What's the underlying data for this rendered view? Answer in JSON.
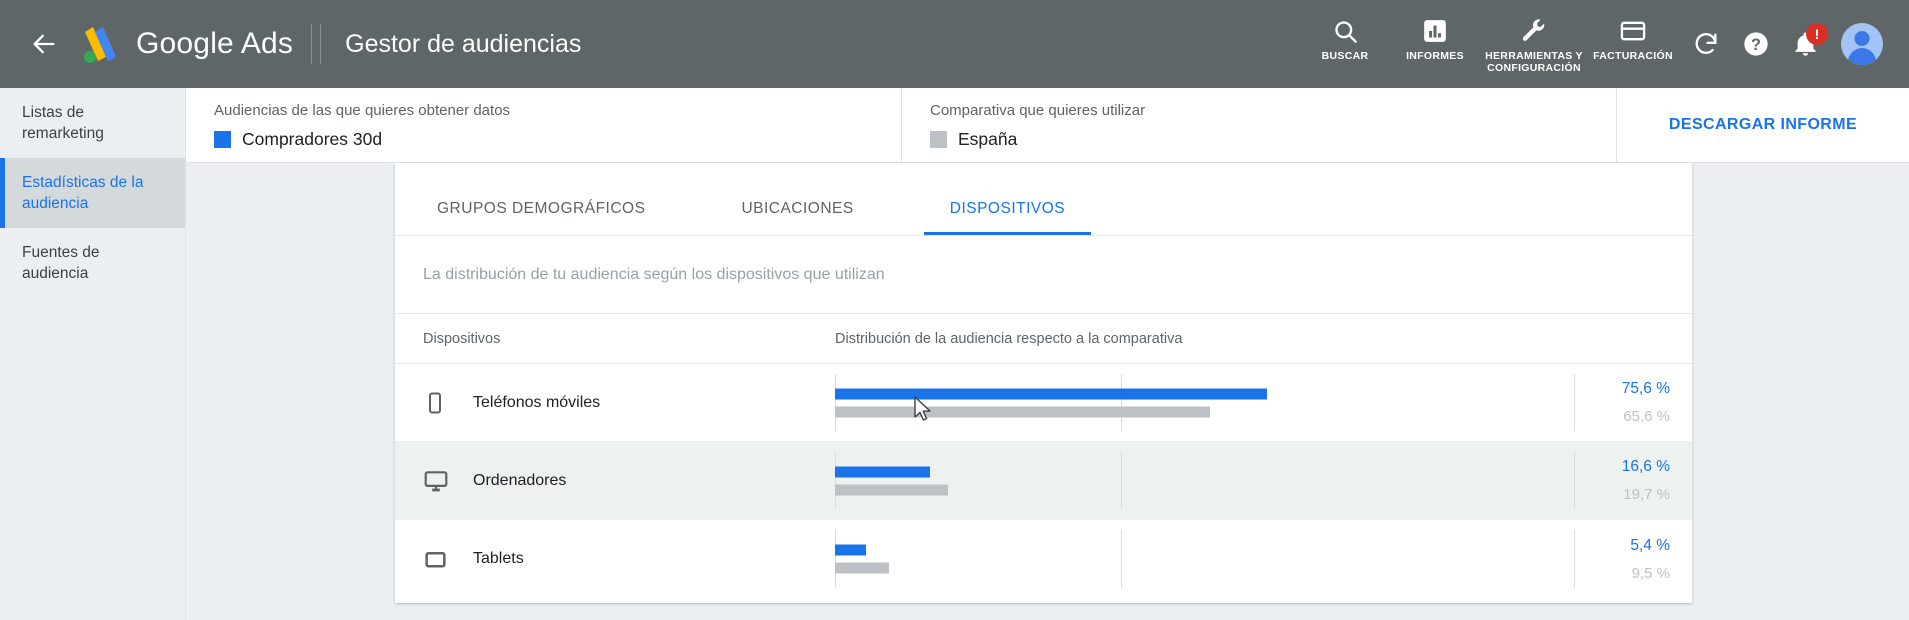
{
  "topbar": {
    "back_icon": "back-arrow-icon",
    "brand": "Google Ads",
    "page_title": "Gestor de audiencias",
    "tools": [
      {
        "label": "BUSCAR",
        "icon": "search-icon"
      },
      {
        "label": "INFORMES",
        "icon": "reports-bar-chart-icon"
      },
      {
        "label": "HERRAMIENTAS Y CONFIGURACIÓN",
        "icon": "wrench-tools-icon"
      },
      {
        "label": "FACTURACIÓN",
        "icon": "credit-card-icon"
      }
    ],
    "round_buttons": [
      {
        "icon": "refresh-icon"
      },
      {
        "icon": "help-question-icon"
      },
      {
        "icon": "notifications-bell-icon",
        "badge": "!"
      }
    ],
    "avatar": "user-avatar"
  },
  "sidebar": {
    "items": [
      {
        "label": "Listas de remarketing",
        "active": false
      },
      {
        "label": "Estadísticas de la audiencia",
        "active": true
      },
      {
        "label": "Fuentes de audiencia",
        "active": false
      }
    ]
  },
  "filterbar": {
    "audience": {
      "label": "Audiencias de las que quieres obtener datos",
      "value": "Compradores 30d",
      "swatch_color": "#1a73e8"
    },
    "benchmark": {
      "label": "Comparativa que quieres utilizar",
      "value": "España",
      "swatch_color": "#bdc1c6"
    },
    "download_label": "DESCARGAR INFORME"
  },
  "card": {
    "tabs": [
      {
        "label": "GRUPOS DEMOGRÁFICOS",
        "active": false
      },
      {
        "label": "UBICACIONES",
        "active": false
      },
      {
        "label": "DISPOSITIVOS",
        "active": true
      }
    ],
    "description": "La distribución de tu audiencia según los dispositivos que utilizan",
    "columns": {
      "device": "Dispositivos",
      "distribution": "Distribución de la audiencia respecto a la comparativa"
    }
  },
  "chart_data": {
    "type": "bar",
    "title": "Distribución de la audiencia respecto a la comparativa",
    "subtitle": "La distribución de tu audiencia según los dispositivos que utilizan",
    "orientation": "horizontal",
    "categories": [
      "Teléfonos móviles",
      "Ordenadores",
      "Tablets"
    ],
    "category_icons": [
      "mobile-phone-icon",
      "desktop-monitor-icon",
      "tablet-icon"
    ],
    "series": [
      {
        "name": "Compradores 30d",
        "color": "#1a73e8",
        "values": [
          75.6,
          16.6,
          5.4
        ],
        "labels": [
          "75,6 %",
          "16,6 %",
          "5,4 %"
        ]
      },
      {
        "name": "España",
        "color": "#bdc1c6",
        "values": [
          65.6,
          19.7,
          9.5
        ],
        "labels": [
          "65,6 %",
          "19,7 %",
          "9,5 %"
        ]
      }
    ],
    "xlabel": "",
    "ylabel": "",
    "xlim": [
      0,
      100
    ],
    "gridlines": [
      0,
      50
    ],
    "grid": true,
    "legend_position": "top-filter-bar"
  },
  "rows": [
    {
      "device": "Teléfonos móviles",
      "icon": "mobile-phone-icon",
      "main_value": "75,6 %",
      "sub_value": "65,6 %",
      "main_pct": 75.6,
      "sub_pct": 65.6,
      "hover": false
    },
    {
      "device": "Ordenadores",
      "icon": "desktop-monitor-icon",
      "main_value": "16,6 %",
      "sub_value": "19,7 %",
      "main_pct": 16.6,
      "sub_pct": 19.7,
      "hover": true
    },
    {
      "device": "Tablets",
      "icon": "tablet-icon",
      "main_value": "5,4 %",
      "sub_value": "9,5 %",
      "main_pct": 5.4,
      "sub_pct": 9.5,
      "hover": false
    }
  ]
}
